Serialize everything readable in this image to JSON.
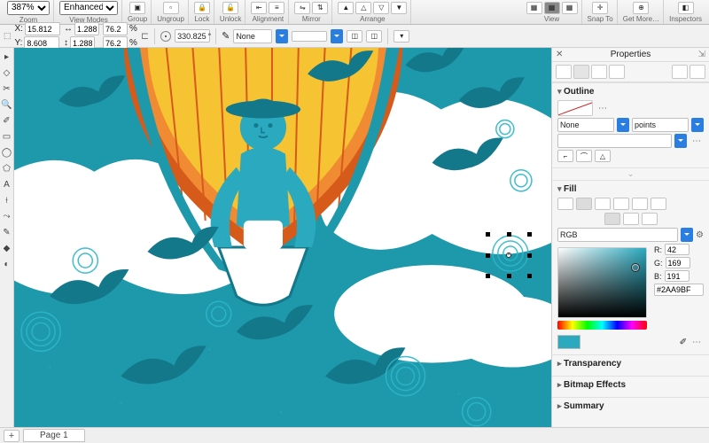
{
  "toolbar": {
    "zoom": "387%",
    "zoom_label": "Zoom",
    "viewmodes_label": "View Modes",
    "viewmodes_sel": "Enhanced",
    "group_label": "Group",
    "ungroup_label": "Ungroup",
    "lock_label": "Lock",
    "unlock_label": "Unlock",
    "alignment_label": "Alignment",
    "mirror_label": "Mirror",
    "arrange_label": "Arrange",
    "view_label": "View",
    "snap_label": "Snap To",
    "getmore_label": "Get More…",
    "inspectors_label": "Inspectors"
  },
  "propbar": {
    "x_label": "X:",
    "y_label": "Y:",
    "x": "15.812",
    "y": "8.608",
    "w": "1.288",
    "h": "1.288",
    "pct1": "76.2",
    "pct2": "76.2",
    "pct_unit": "%",
    "rotation": "330.825",
    "deg": "°",
    "stroke_sel": "None"
  },
  "panel": {
    "title": "Properties",
    "outline_title": "Outline",
    "outline_mode": "None",
    "outline_unit": "points",
    "fill_title": "Fill",
    "color_mode": "RGB",
    "r_label": "R:",
    "g_label": "G:",
    "b_label": "B:",
    "r": "42",
    "g": "169",
    "b": "191",
    "hex": "#2AA9BF",
    "transparency": "Transparency",
    "bitmap": "Bitmap Effects",
    "summary": "Summary"
  },
  "pagebar": {
    "add": "+",
    "page": "Page 1"
  },
  "colors": {
    "fill": "#2AA9BF",
    "teal": "#1d99ab",
    "tealdark": "#13788a",
    "orange": "#f08a33",
    "orangedk": "#d65a1a",
    "yellow": "#f6c333",
    "skin": "#2AA9BF",
    "cloud": "#ffffff"
  }
}
